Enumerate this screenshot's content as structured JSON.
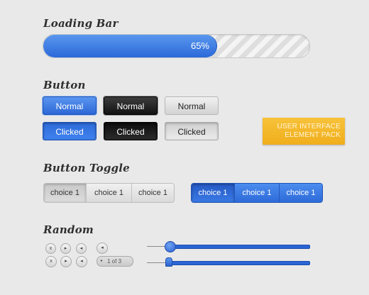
{
  "headings": {
    "loading": "Loading Bar",
    "button": "Button",
    "toggle": "Button Toggle",
    "random": "Random"
  },
  "loading_bar": {
    "progress_percent": 65,
    "label": "65%"
  },
  "buttons": {
    "normal": [
      "Normal",
      "Normal",
      "Normal"
    ],
    "clicked": [
      "Clicked",
      "Clicked",
      "Clicked"
    ]
  },
  "badge": {
    "line1": "USER INTERFACE",
    "line2": "ELEMENT PACK"
  },
  "toggles": {
    "gray": [
      "choice 1",
      "choice 1",
      "choice 1"
    ],
    "blue": [
      "choice 1",
      "choice 1",
      "choice 1"
    ]
  },
  "random": {
    "small_buttons_row1": [
      "x",
      "▸",
      "◂"
    ],
    "small_buttons_row2": [
      "x",
      "▸",
      "◂"
    ],
    "speaker_symbol": "◂",
    "pager_arrow": "◂",
    "pager_text": "1 of 3",
    "slider1_value_percent": 14,
    "slider2_value_percent": 13
  },
  "colors": {
    "accent_blue": "#2e6bd9",
    "badge_yellow": "#f2b52a",
    "background": "#e9e9e9"
  }
}
